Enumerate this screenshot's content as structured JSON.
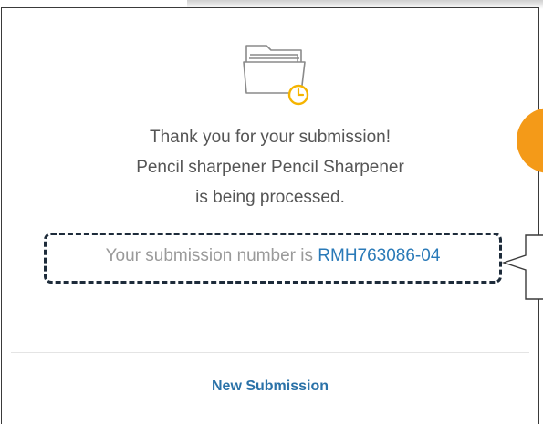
{
  "dialog": {
    "icon": "folder-clock-icon",
    "message_line1": "Thank you for your submission!",
    "message_line2": "Pencil sharpener Pencil Sharpener",
    "message_line3": "is being processed.",
    "submission_label": "Your submission number is ",
    "submission_number": "RMH763086-04",
    "new_submission_label": "New Submission"
  },
  "colors": {
    "accent_link": "#2a72a8",
    "callout_orange": "#f49a18",
    "highlight_border": "#1d2b3a",
    "text_gray": "#555555"
  }
}
